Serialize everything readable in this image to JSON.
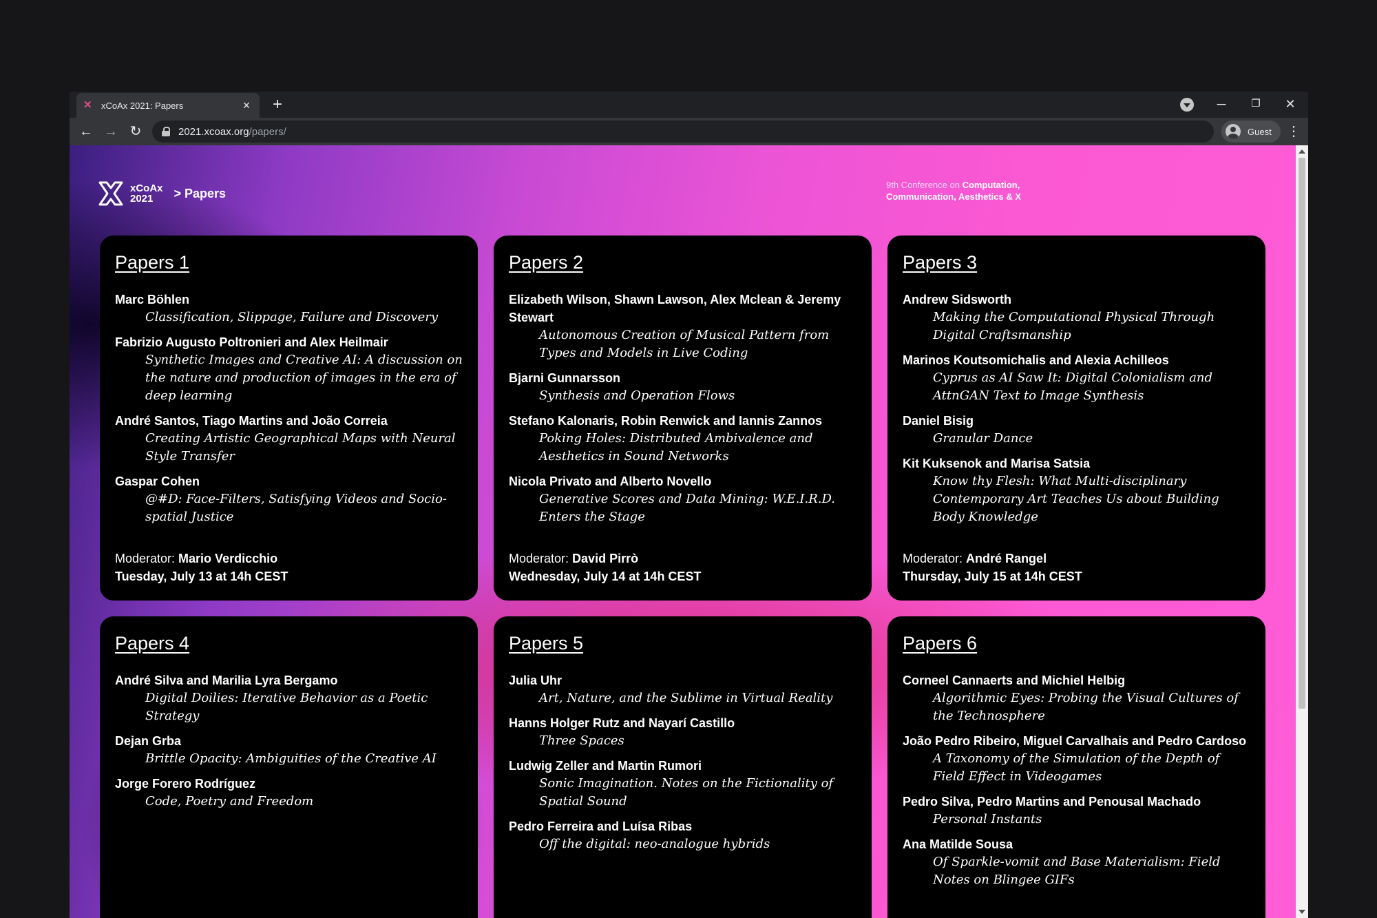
{
  "browser": {
    "tab_title": "xCoAx 2021: Papers",
    "new_tab": "+",
    "url_host": "2021.xcoax.org",
    "url_path": "/papers/",
    "profile_label": "Guest"
  },
  "site": {
    "logo_line1": "xCoAx",
    "logo_line2": "2021",
    "breadcrumb": "> Papers",
    "tagline_prefix": "9th Conference on ",
    "tagline_bold1": "Computation,",
    "tagline_bold2": "Communication, Aesthetics & X"
  },
  "moderator_label": "Moderator: ",
  "sessions": [
    {
      "title": "Papers 1",
      "papers": [
        {
          "authors": "Marc Böhlen",
          "title": "Classification, Slippage, Failure and Discovery"
        },
        {
          "authors": "Fabrizio Augusto Poltronieri and Alex Heilmair",
          "title": "Synthetic Images and Creative AI: A discussion on the nature and production of images in the era of deep learning"
        },
        {
          "authors": "André Santos, Tiago Martins and João Correia",
          "title": "Creating Artistic Geographical Maps with Neural Style Transfer"
        },
        {
          "authors": "Gaspar Cohen",
          "title": "@#D: Face-Filters, Satisfying Videos and Socio-spatial Justice"
        }
      ],
      "moderator": "Mario Verdicchio",
      "date": "Tuesday, July 13 at 14h CEST"
    },
    {
      "title": "Papers 2",
      "papers": [
        {
          "authors": "Elizabeth Wilson, Shawn Lawson, Alex Mclean & Jeremy Stewart",
          "title": "Autonomous Creation of Musical Pattern from Types and Models in Live Coding"
        },
        {
          "authors": "Bjarni Gunnarsson",
          "title": "Synthesis and Operation Flows"
        },
        {
          "authors": "Stefano Kalonaris, Robin Renwick and Iannis Zannos",
          "title": "Poking Holes: Distributed Ambivalence and Aesthetics in Sound Networks"
        },
        {
          "authors": "Nicola Privato and Alberto Novello",
          "title": "Generative Scores and Data Mining: W.E.I.R.D. Enters the Stage"
        }
      ],
      "moderator": "David Pirrò",
      "date": "Wednesday, July 14 at 14h CEST"
    },
    {
      "title": "Papers 3",
      "papers": [
        {
          "authors": "Andrew Sidsworth",
          "title": "Making the Computational Physical Through Digital Craftsmanship"
        },
        {
          "authors": "Marinos Koutsomichalis and Alexia Achilleos",
          "title": "Cyprus as AI Saw It: Digital Colonialism and AttnGAN Text to Image Synthesis"
        },
        {
          "authors": "Daniel Bisig",
          "title": "Granular Dance"
        },
        {
          "authors": "Kit Kuksenok and Marisa Satsia",
          "title": "Know thy Flesh: What Multi-disciplinary Contemporary Art Teaches Us about Building Body Knowledge"
        }
      ],
      "moderator": "André Rangel",
      "date": "Thursday, July 15 at 14h CEST"
    },
    {
      "title": "Papers 4",
      "papers": [
        {
          "authors": "André Silva and Marilia Lyra Bergamo",
          "title": "Digital Doilies: Iterative Behavior as a Poetic Strategy"
        },
        {
          "authors": "Dejan Grba",
          "title": "Brittle Opacity: Ambiguities of the Creative AI"
        },
        {
          "authors": "Jorge Forero Rodríguez",
          "title": "Code, Poetry and Freedom"
        }
      ]
    },
    {
      "title": "Papers 5",
      "papers": [
        {
          "authors": "Julia Uhr",
          "title": "Art, Nature, and the Sublime in Virtual Reality"
        },
        {
          "authors": "Hanns Holger Rutz and Nayarí Castillo",
          "title": "Three Spaces"
        },
        {
          "authors": "Ludwig Zeller and Martin Rumori",
          "title": "Sonic Imagination. Notes on the Fictionality of Spatial Sound"
        },
        {
          "authors": "Pedro Ferreira and Luísa Ribas",
          "title": "Off the digital: neo-analogue hybrids"
        }
      ]
    },
    {
      "title": "Papers 6",
      "papers": [
        {
          "authors": "Corneel Cannaerts and Michiel Helbig",
          "title": "Algorithmic Eyes: Probing the Visual Cultures of the Technosphere"
        },
        {
          "authors": "João Pedro Ribeiro, Miguel Carvalhais and Pedro Cardoso",
          "title": "A Taxonomy of the Simulation of the Depth of Field Effect in Videogames"
        },
        {
          "authors": "Pedro Silva, Pedro Martins and Penousal Machado",
          "title": "Personal Instants"
        },
        {
          "authors": "Ana Matilde Sousa",
          "title": "Of Sparkle-vomit and Base Materialism: Field Notes on Blingee GIFs"
        }
      ]
    }
  ]
}
